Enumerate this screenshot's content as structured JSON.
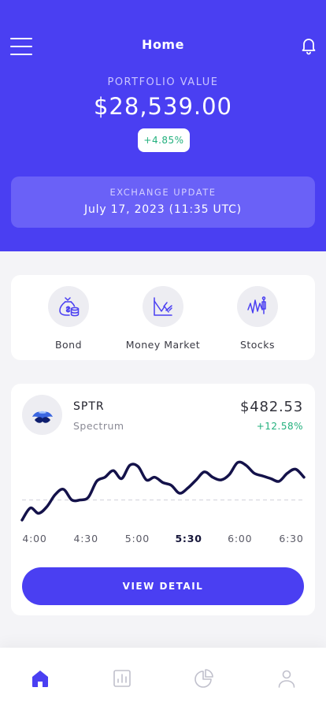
{
  "header": {
    "title": "Home",
    "portfolio_label": "PORTFOLIO VALUE",
    "portfolio_value": "$28,539.00",
    "portfolio_change": "+4.85%",
    "exchange_label": "EXCHANGE UPDATE",
    "exchange_date": "July 17, 2023 (11:35 UTC)"
  },
  "categories": [
    {
      "label": "Bond",
      "icon": "money-bag-icon"
    },
    {
      "label": "Money Market",
      "icon": "chart-declining-icon"
    },
    {
      "label": "Stocks",
      "icon": "stock-chart-icon"
    }
  ],
  "stock": {
    "ticker": "SPTR",
    "company": "Spectrum",
    "price": "$482.53",
    "change": "+12.58%",
    "button_label": "VIEW DETAIL"
  },
  "chart_data": {
    "type": "line",
    "x": [
      "4:00",
      "4:30",
      "5:00",
      "5:30",
      "6:00",
      "6:30"
    ],
    "selected_x": "5:30",
    "series": [
      {
        "values": [
          0.0,
          0.9,
          0.5,
          1.0,
          1.9,
          2.3,
          1.5,
          1.5,
          1.7,
          2.9,
          3.2,
          3.7,
          3.1,
          4.1,
          4.0,
          3.0,
          3.2,
          2.8,
          2.6,
          2.0,
          2.4,
          3.0,
          3.6,
          3.2,
          3.0,
          3.4,
          4.3,
          4.1,
          3.5,
          3.3,
          3.1,
          2.9,
          3.5,
          3.8,
          3.2
        ]
      }
    ],
    "reference_value": 1.5,
    "colors": {
      "line": "#14124a",
      "reference": "#d8d8e0"
    }
  },
  "nav": [
    {
      "name": "home",
      "icon": "home-icon",
      "active": true
    },
    {
      "name": "analytics",
      "icon": "bar-chart-icon",
      "active": false
    },
    {
      "name": "portfolio",
      "icon": "pie-chart-icon",
      "active": false
    },
    {
      "name": "profile",
      "icon": "user-icon",
      "active": false
    }
  ],
  "colors": {
    "primary": "#4a3ff2",
    "positive": "#22b07d",
    "muted": "#c0c0cc"
  }
}
